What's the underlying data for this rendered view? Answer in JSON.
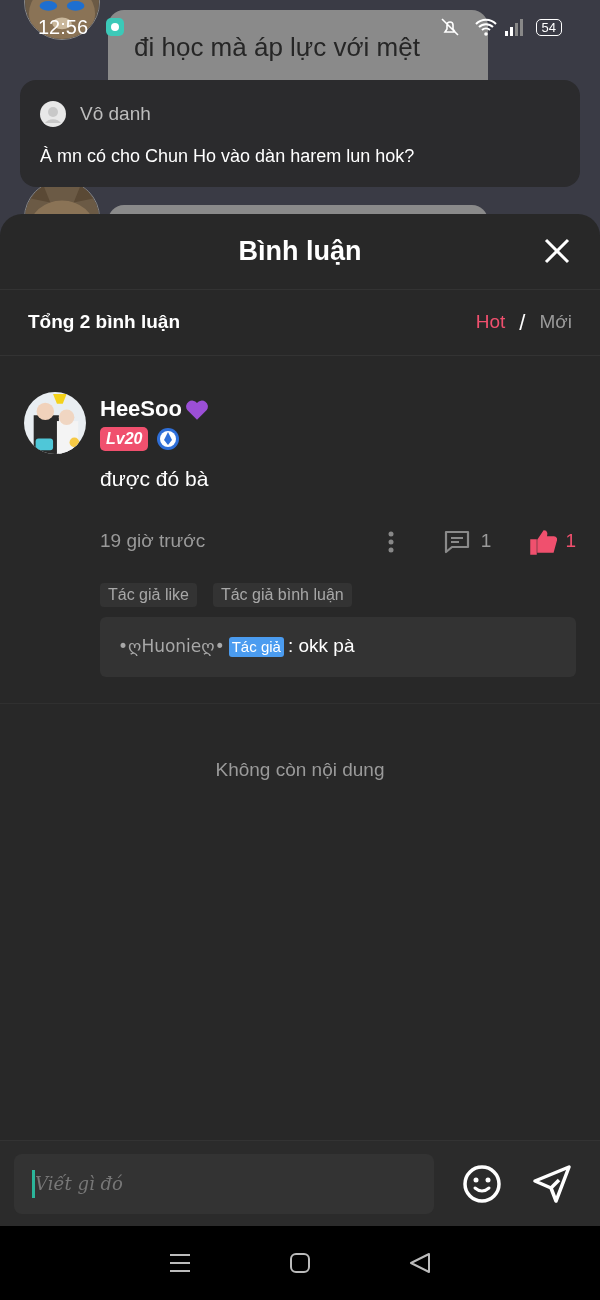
{
  "status_bar": {
    "time": "12:56",
    "battery": "54"
  },
  "chat_behind": {
    "message": "đi học mà áp lực với mệt"
  },
  "notification": {
    "sender": "Vô danh",
    "text": "À mn có cho Chun Ho vào dàn harem lun hok?"
  },
  "sheet": {
    "title": "Bình luận",
    "total": "Tổng 2 bình luận",
    "separator": "/",
    "sort_tabs": [
      {
        "label": "Hot",
        "selected": true
      },
      {
        "label": "Mới",
        "selected": false
      }
    ]
  },
  "comments": [
    {
      "user": "HeeSoo",
      "level_badge": "Lv20",
      "text": "được đó bà",
      "time": "19 giờ trước",
      "reply_count": "1",
      "like_count": "1",
      "liked": true,
      "tags": [
        "Tác giả like",
        "Tác giả bình luận"
      ],
      "replies": [
        {
          "user": "•ღHuonieღ•",
          "badge": "Tác giả",
          "text": ": okk pà"
        }
      ]
    }
  ],
  "end_text": "Không còn nội dung",
  "composer": {
    "placeholder": "Viết gì đó"
  }
}
